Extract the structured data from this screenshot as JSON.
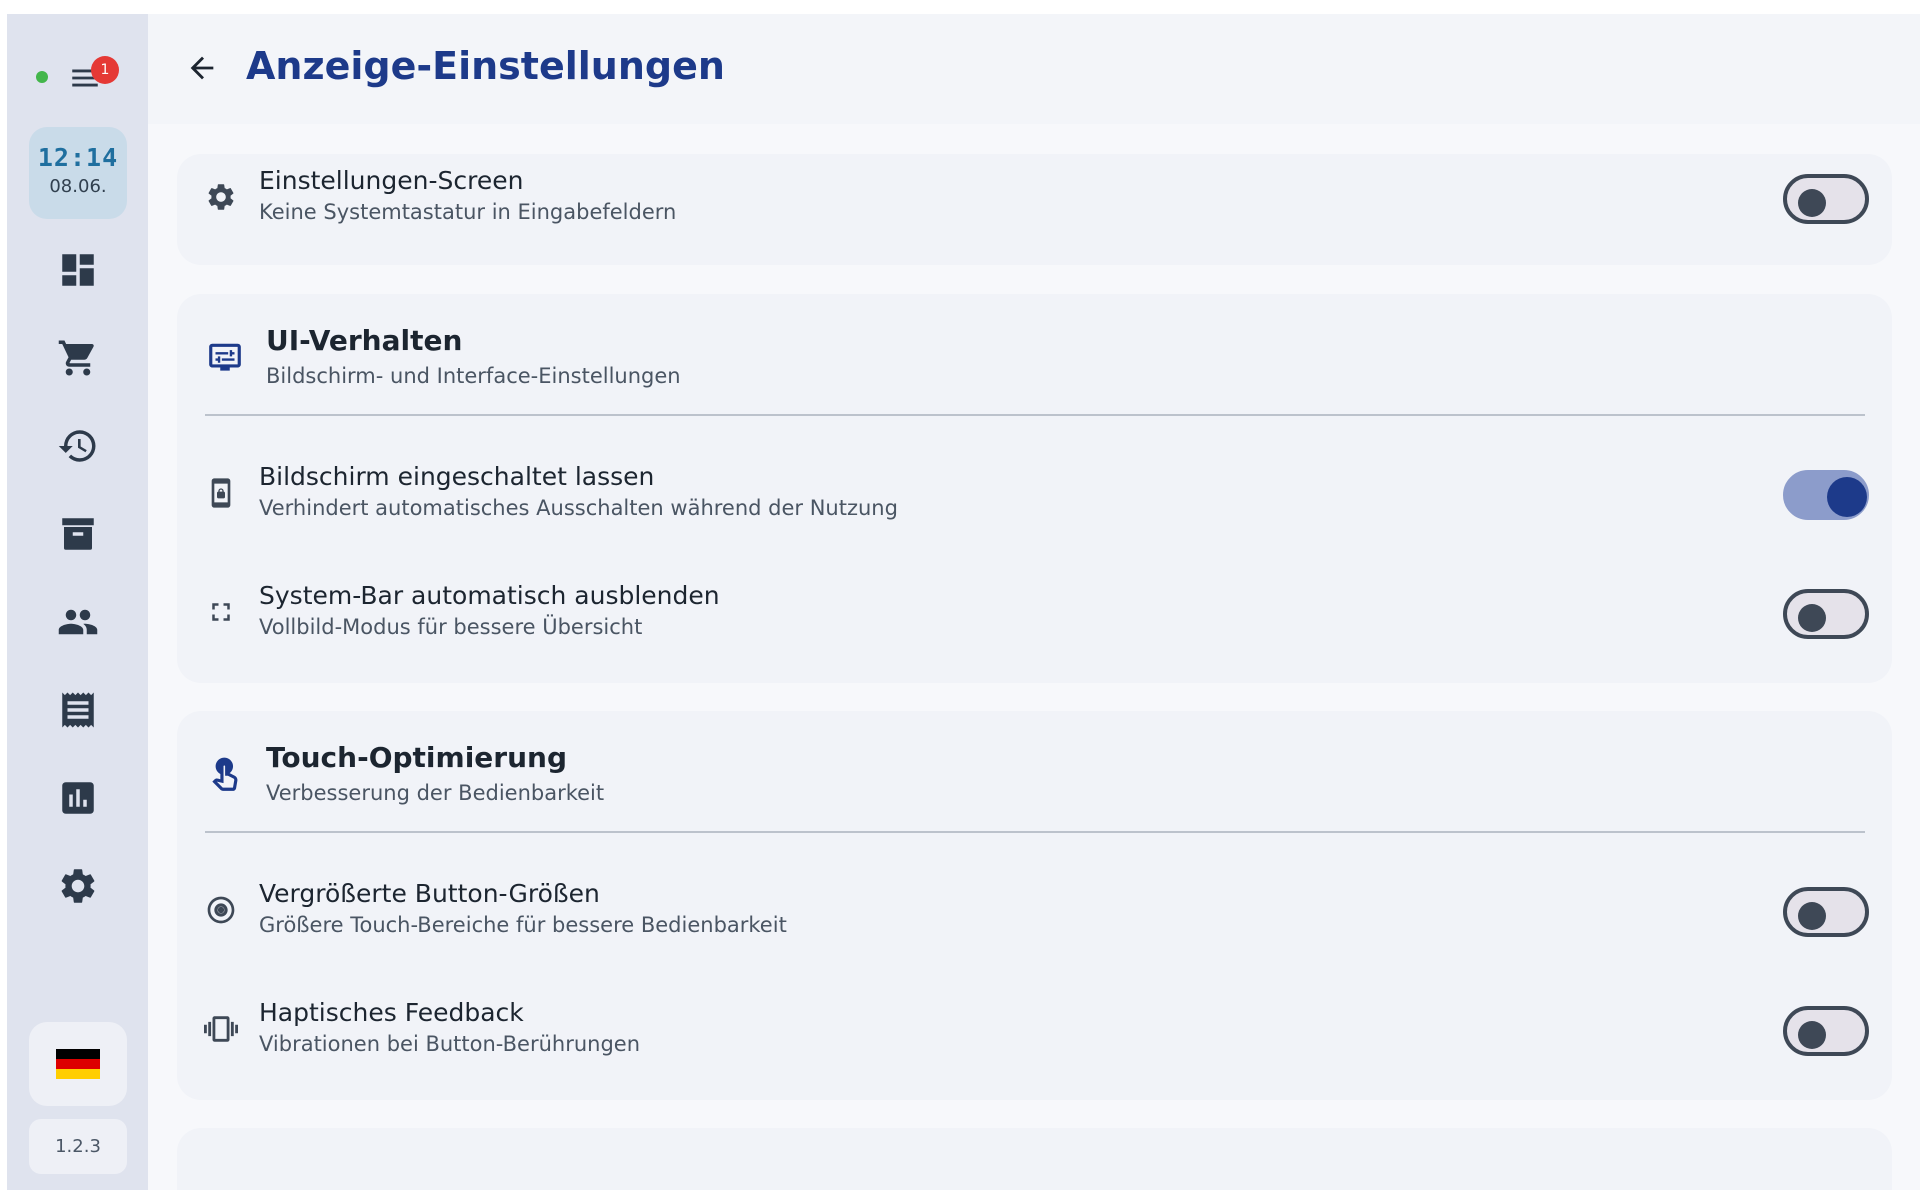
{
  "rail": {
    "badge_count": "1",
    "clock": {
      "time": "12:14",
      "date": "08.06."
    },
    "version": "1.2.3",
    "nav": [
      "dashboard-icon",
      "cart-icon",
      "history-icon",
      "archive-icon",
      "people-icon",
      "receipt-icon",
      "chart-icon",
      "gear-icon"
    ]
  },
  "header": {
    "title": "Anzeige-Einstellungen"
  },
  "top_row": {
    "title": "Einstellungen-Screen",
    "subtitle": "Keine Systemtastatur in Eingabefeldern",
    "enabled": false
  },
  "ui_section": {
    "title": "UI-Verhalten",
    "subtitle": "Bildschirm- und Interface-Einstellungen",
    "rows": [
      {
        "title": "Bildschirm eingeschaltet lassen",
        "subtitle": "Verhindert automatisches Ausschalten während der Nutzung",
        "enabled": true
      },
      {
        "title": "System-Bar automatisch ausblenden",
        "subtitle": "Vollbild-Modus für bessere Übersicht",
        "enabled": false
      }
    ]
  },
  "touch_section": {
    "title": "Touch-Optimierung",
    "subtitle": "Verbesserung der Bedienbarkeit",
    "rows": [
      {
        "title": "Vergrößerte Button-Größen",
        "subtitle": "Größere Touch-Bereiche für bessere Bedienbarkeit",
        "enabled": false
      },
      {
        "title": "Haptisches Feedback",
        "subtitle": "Vibrationen bei Button-Berührungen",
        "enabled": false
      }
    ]
  },
  "colors": {
    "accent": "#1d3a8a",
    "rail": "#dfe3ee",
    "toggle_on_track": "#8c9ccb"
  }
}
